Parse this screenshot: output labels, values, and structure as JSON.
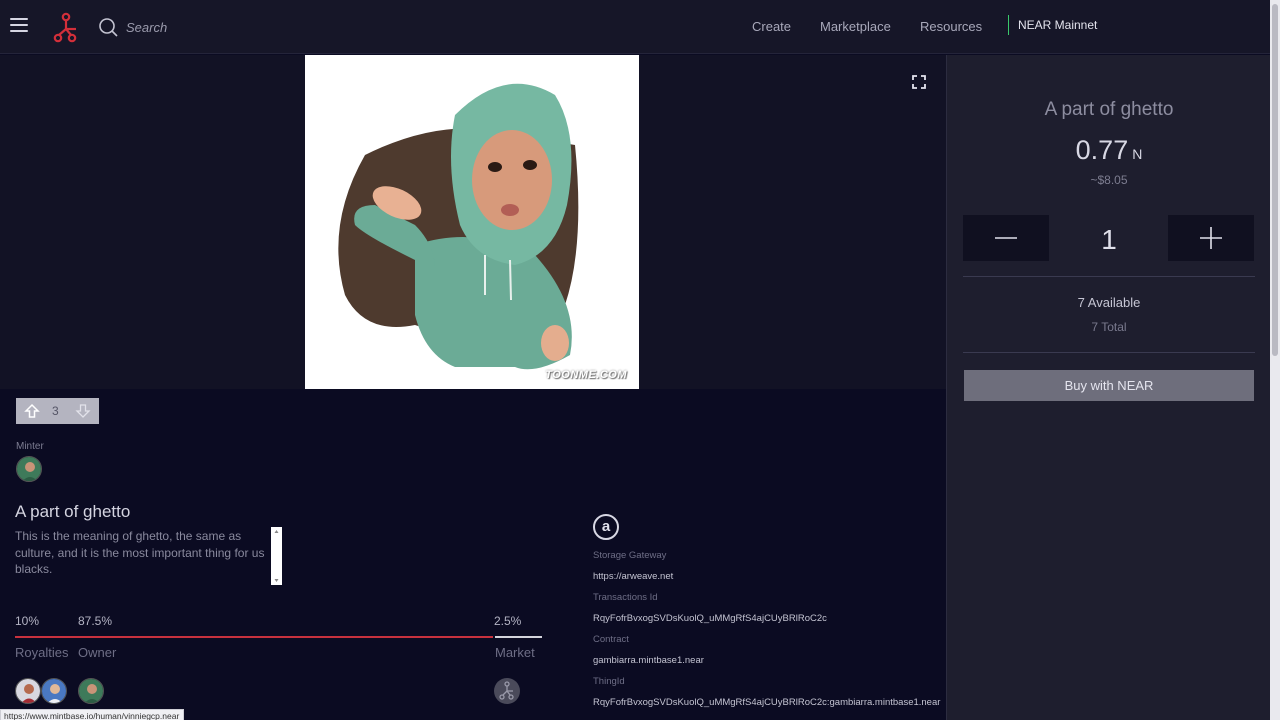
{
  "nav": {
    "search_placeholder": "Search",
    "links": [
      "Create",
      "Marketplace",
      "Resources"
    ],
    "network": "NEAR Mainnet"
  },
  "image": {
    "watermark": "TOONME.COM"
  },
  "panel": {
    "title": "A part of ghetto",
    "price": "0.77",
    "price_unit": "N",
    "usd": "~$8.05",
    "quantity": "1",
    "available": "7 Available",
    "total": "7 Total",
    "buy_label": "Buy with NEAR"
  },
  "votes": {
    "count": "3"
  },
  "minter": {
    "label": "Minter"
  },
  "details": {
    "title": "A part of ghetto",
    "description": "This is the meaning of ghetto, the same as culture, and it is the most important thing for us blacks."
  },
  "split": {
    "royalties_pct": "10%",
    "owner_pct": "87.5%",
    "market_pct": "2.5%",
    "royalties_label": "Royalties",
    "owner_label": "Owner",
    "market_label": "Market",
    "royalties_pct_value": 10,
    "owner_pct_value": 87.5,
    "market_pct_value": 2.5,
    "bar_color": "#c8313e",
    "market_bar_color": "#d4d4dc"
  },
  "storage": {
    "icon_letter": "a",
    "gateway_label": "Storage Gateway",
    "gateway": "https://arweave.net",
    "tx_label": "Transactions Id",
    "tx": "RqyFofrBvxogSVDsKuolQ_uMMgRfS4ajCUyBRlRoC2c",
    "contract_label": "Contract",
    "contract": "gambiarra.mintbase1.near",
    "thing_label": "ThingId",
    "thing": "RqyFofrBvxogSVDsKuolQ_uMMgRfS4ajCUyBRlRoC2c:gambiarra.mintbase1.near"
  },
  "status_url": "https://www.mintbase.io/human/vinniegcp.near",
  "colors": {
    "background": "#0b0b22",
    "topbar": "#161628",
    "panel": "#1e1e2e",
    "accent_red": "#d32f3a",
    "network_green": "#39c96b"
  }
}
